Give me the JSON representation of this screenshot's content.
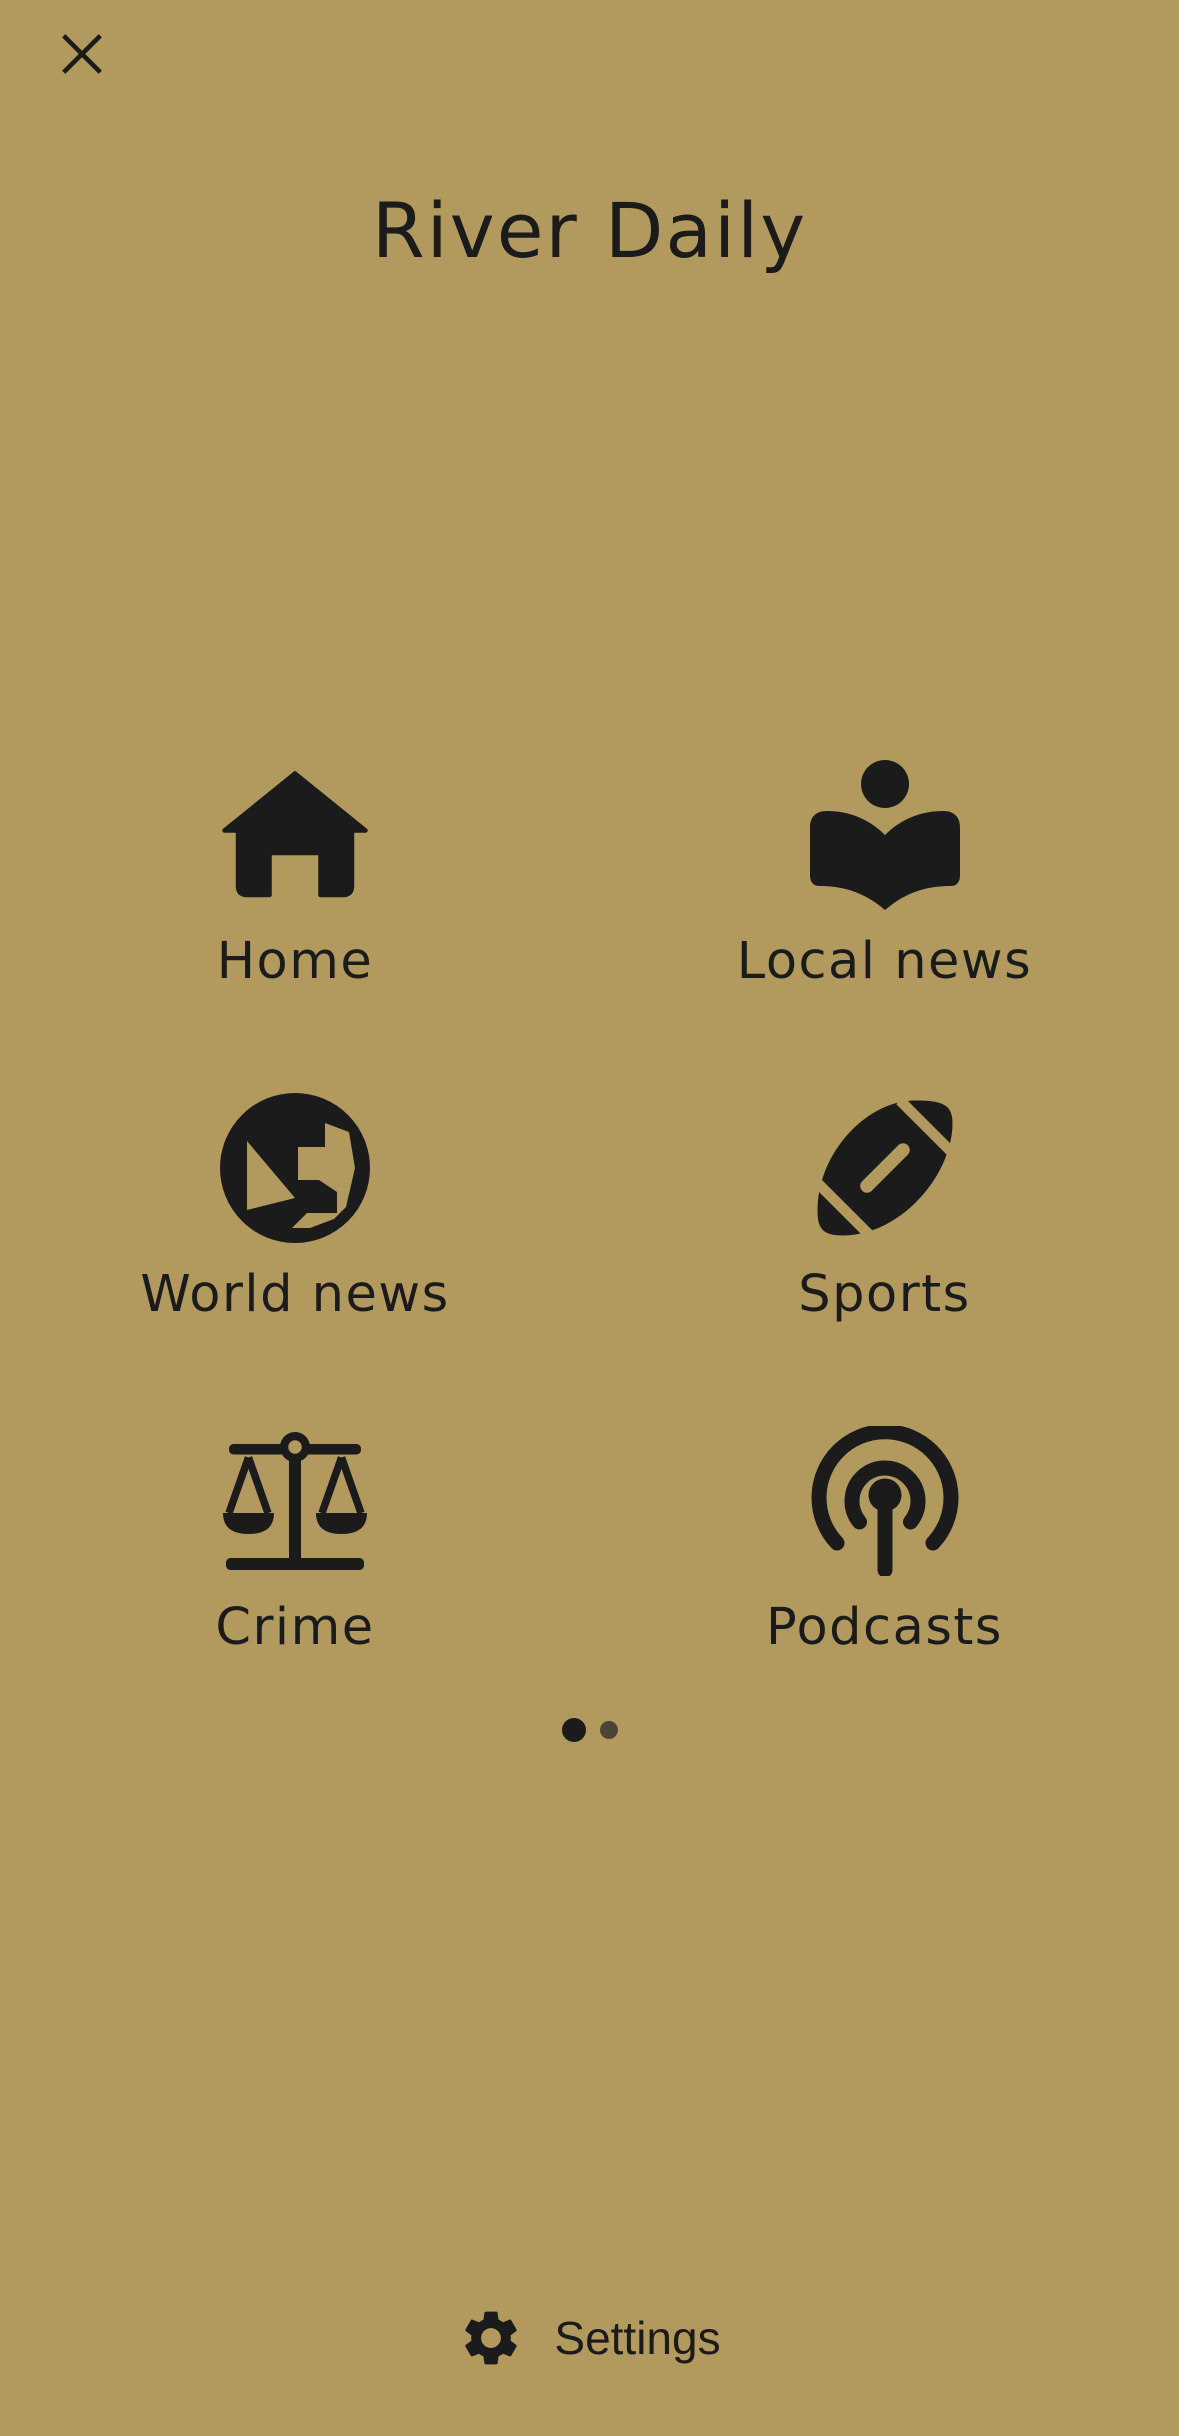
{
  "header": {
    "title": "River Daily",
    "close_icon": "close-icon"
  },
  "nav_items": [
    {
      "label": "Home",
      "icon": "home-icon"
    },
    {
      "label": "Local news",
      "icon": "local-news-icon"
    },
    {
      "label": "World news",
      "icon": "globe-icon"
    },
    {
      "label": "Sports",
      "icon": "football-icon"
    },
    {
      "label": "Crime",
      "icon": "scales-icon"
    },
    {
      "label": "Podcasts",
      "icon": "podcast-icon"
    }
  ],
  "pagination": {
    "current_page": 1,
    "total_pages": 2
  },
  "footer": {
    "settings_label": "Settings",
    "settings_icon": "gear-icon"
  },
  "colors": {
    "background": "#b29a5e",
    "foreground": "#1b1b1b",
    "inactive_dot": "#4c4536"
  }
}
